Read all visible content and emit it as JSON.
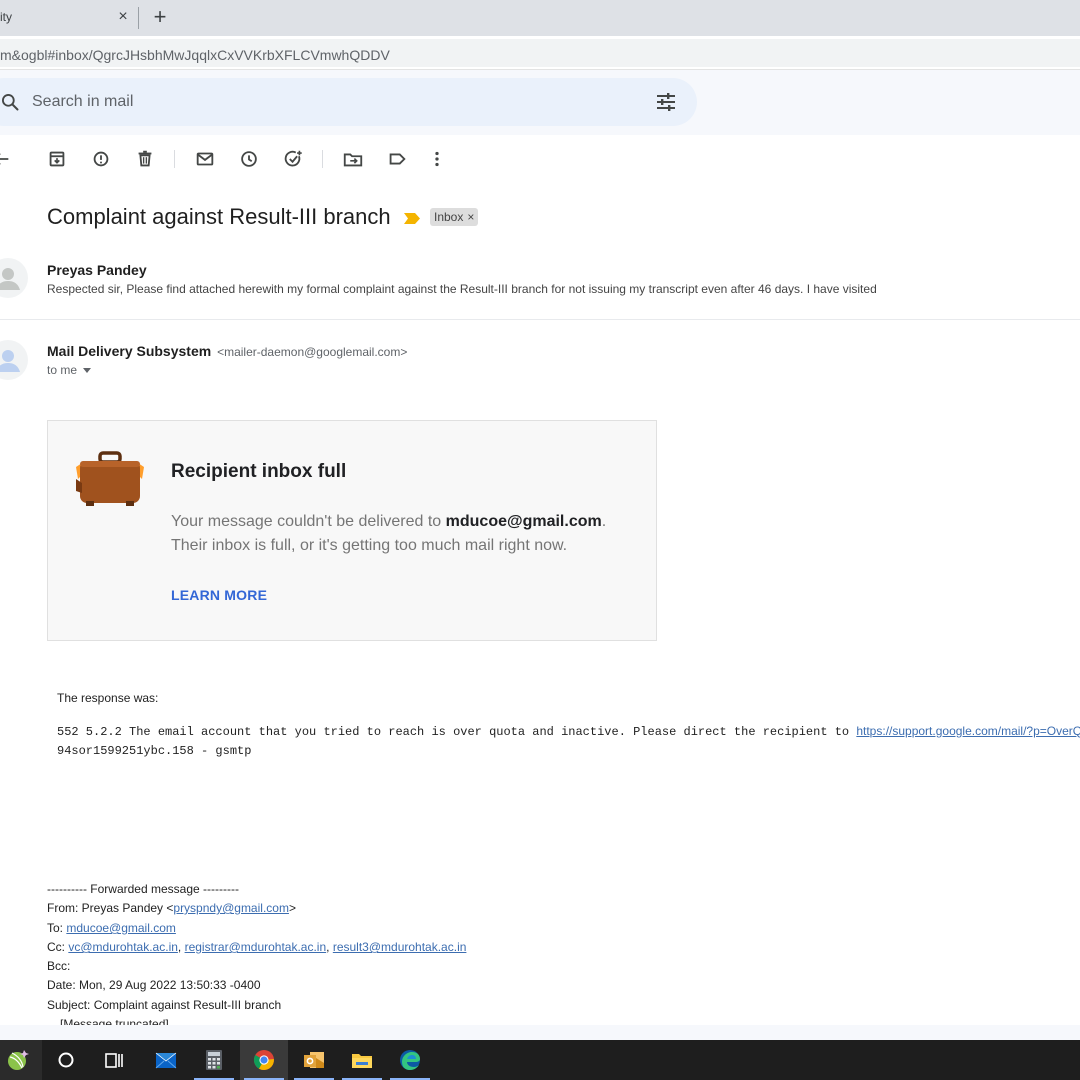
{
  "browser": {
    "tab_title": "ity",
    "tab_close": "×",
    "new_tab": "+",
    "url": "m&ogbl#inbox/QgrcJHsbhMwJqqlxCxVVKrbXFLCVmwhQDDV"
  },
  "search": {
    "placeholder": "Search in mail"
  },
  "thread": {
    "subject": "Complaint against Result-III branch",
    "label": "Inbox",
    "label_remove": "×"
  },
  "messages": [
    {
      "sender": "Preyas Pandey",
      "snippet": "Respected sir, Please find attached herewith my formal complaint against the Result-III branch for not issuing my transcript even after 46 days. I have visited"
    },
    {
      "sender": "Mail Delivery Subsystem",
      "email": "<mailer-daemon@googlemail.com>",
      "to": "to me"
    }
  ],
  "bounce_card": {
    "title": "Recipient inbox full",
    "line1_prefix": "Your message couldn't be delivered to ",
    "address": "mducoe@gmail.com",
    "line1_suffix": ".",
    "line2": "Their inbox is full, or it's getting too much mail right now.",
    "learn_more": "LEARN MORE"
  },
  "response": {
    "label": "The response was:",
    "line1_text": "552 5.2.2 The email account that you tried to reach is over quota and inactive. Please direct the recipient to ",
    "line1_link": "https://support.google.com/mail/?p=OverQ",
    "line2": "94sor1599251ybc.158 - gsmtp"
  },
  "forwarded": {
    "header": "---------- Forwarded message ---------",
    "from_label": "From: Preyas Pandey <",
    "from_email": "pryspndy@gmail.com",
    "from_close": ">",
    "to_label": "To: ",
    "to_email": "mducoe@gmail.com",
    "cc_label": "Cc: ",
    "cc_emails": [
      "vc@mdurohtak.ac.in",
      "registrar@mdurohtak.ac.in",
      "result3@mdurohtak.ac.in"
    ],
    "cc_sep": ", ",
    "bcc": "Bcc:",
    "date": "Date: Mon, 29 Aug 2022 13:50:33 -0400",
    "subject": "Subject: Complaint against Result-III branch",
    "truncated": "[Message truncated]"
  },
  "colors": {
    "importance": "#f4b400",
    "link": "#3c6db0",
    "learn_more": "#3367d6",
    "suitcase": "#a0521e",
    "taskbar": "#1e1e1e"
  },
  "toolbar_icons": [
    "back-arrow-icon",
    "archive-icon",
    "report-spam-icon",
    "delete-icon",
    "mark-unread-icon",
    "snooze-icon",
    "add-task-icon",
    "move-to-icon",
    "label-icon",
    "more-icon"
  ],
  "taskbar_icons": [
    "cortana-ball-icon",
    "search-circle-icon",
    "task-view-icon",
    "mail-icon",
    "calculator-icon",
    "chrome-icon",
    "outlook-icon",
    "file-explorer-icon",
    "edge-icon"
  ]
}
